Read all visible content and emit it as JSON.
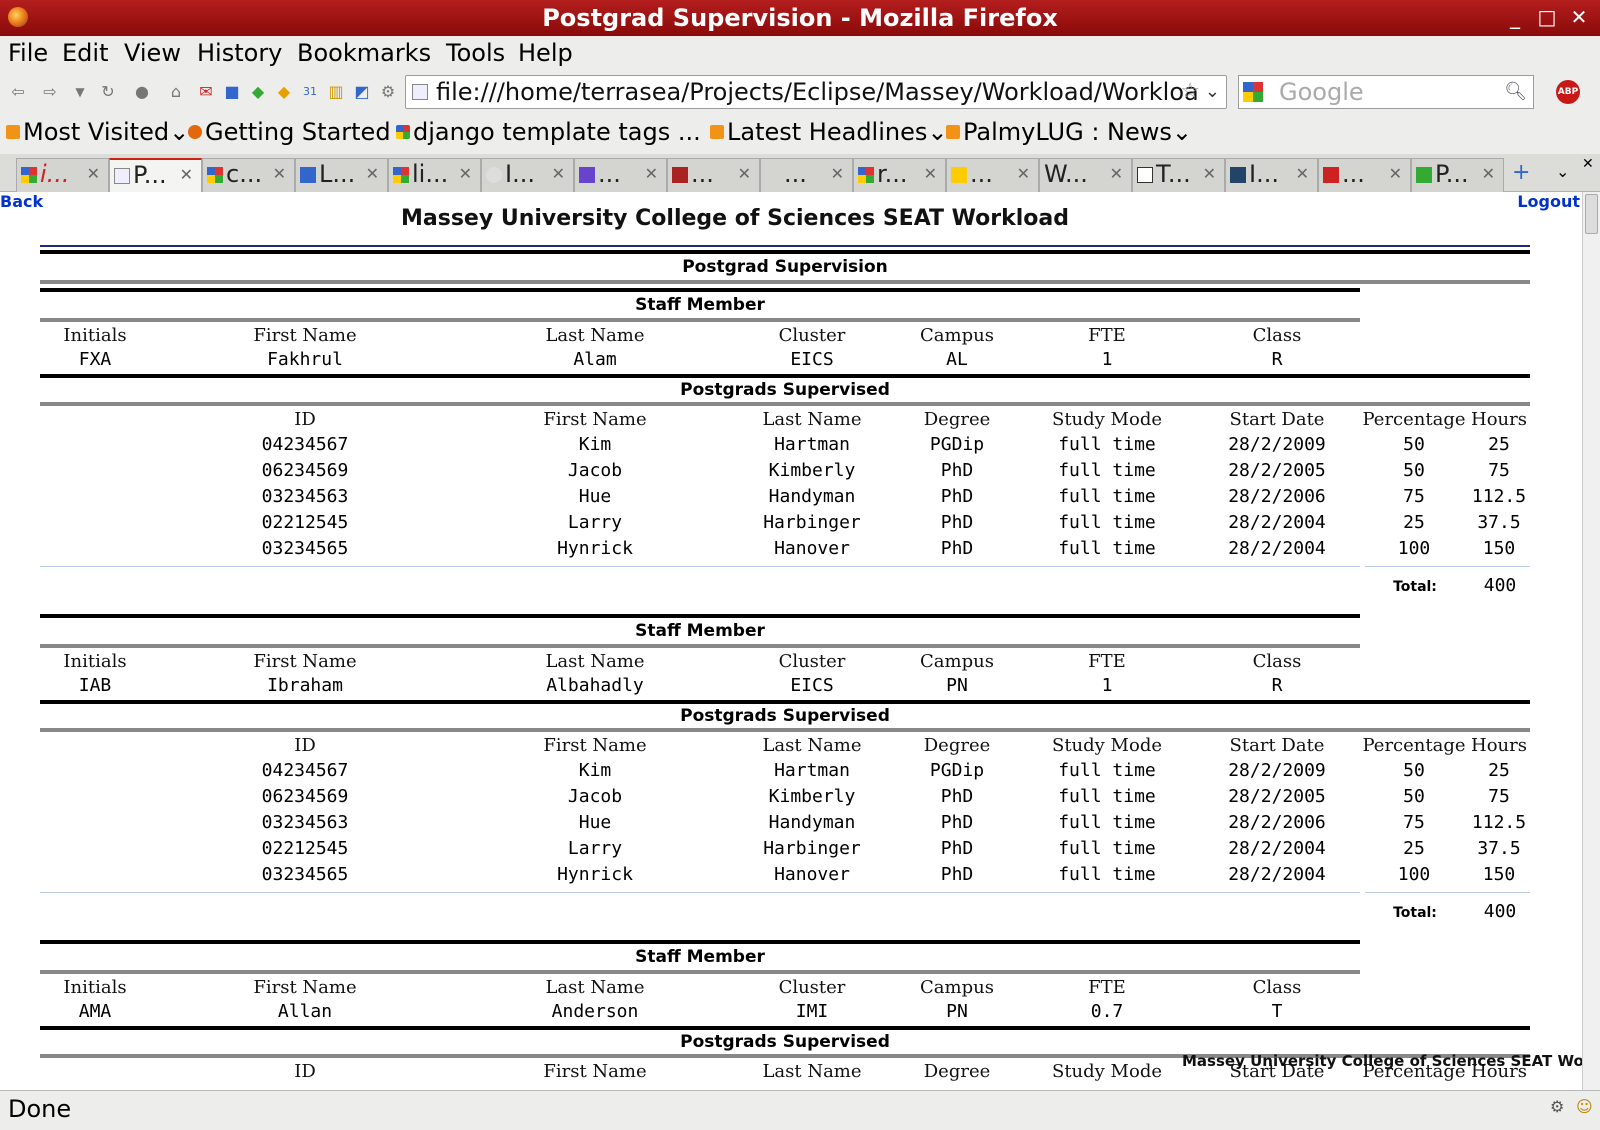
{
  "window": {
    "title": "Postgrad Supervision - Mozilla Firefox"
  },
  "menu": [
    "File",
    "Edit",
    "View",
    "History",
    "Bookmarks",
    "Tools",
    "Help"
  ],
  "nav": {
    "url": "file:///home/terrasea/Projects/Eclipse/Massey/Workload/Workloa",
    "search_placeholder": "Google",
    "abp": "ABP"
  },
  "bookmarks": [
    "Most Visited",
    "Getting Started",
    "django template tags ...",
    "Latest Headlines",
    "PalmyLUG : News"
  ],
  "tabs": [
    "i...",
    "P...",
    "c...",
    "L...",
    "li...",
    "I...",
    "...",
    "...",
    "...",
    "r...",
    "...",
    "W...",
    "T...",
    "I...",
    "...",
    "P..."
  ],
  "page": {
    "back": "Back",
    "logout": "Logout",
    "title": "Massey University College of Sciences SEAT Workload",
    "section": "Postgrad Supervision",
    "staff_heading": "Staff Member",
    "postgrads_heading": "Postgrads Supervised",
    "staff_cols": [
      "Initials",
      "First Name",
      "Last Name",
      "Cluster",
      "Campus",
      "FTE",
      "Class"
    ],
    "pg_cols": [
      "ID",
      "First Name",
      "Last Name",
      "Degree",
      "Study Mode",
      "Start Date",
      "Percentage",
      "Hours"
    ],
    "total_label": "Total:",
    "staff": [
      {
        "row": [
          "FXA",
          "Fakhrul",
          "Alam",
          "EICS",
          "AL",
          "1",
          "R"
        ],
        "postgrads": [
          [
            "04234567",
            "Kim",
            "Hartman",
            "PGDip",
            "full time",
            "28/2/2009",
            "50",
            "25"
          ],
          [
            "06234569",
            "Jacob",
            "Kimberly",
            "PhD",
            "full time",
            "28/2/2005",
            "50",
            "75"
          ],
          [
            "03234563",
            "Hue",
            "Handyman",
            "PhD",
            "full time",
            "28/2/2006",
            "75",
            "112.5"
          ],
          [
            "02212545",
            "Larry",
            "Harbinger",
            "PhD",
            "full time",
            "28/2/2004",
            "25",
            "37.5"
          ],
          [
            "03234565",
            "Hynrick",
            "Hanover",
            "PhD",
            "full time",
            "28/2/2004",
            "100",
            "150"
          ]
        ],
        "total": "400"
      },
      {
        "row": [
          "IAB",
          "Ibraham",
          "Albahadly",
          "EICS",
          "PN",
          "1",
          "R"
        ],
        "postgrads": [
          [
            "04234567",
            "Kim",
            "Hartman",
            "PGDip",
            "full time",
            "28/2/2009",
            "50",
            "25"
          ],
          [
            "06234569",
            "Jacob",
            "Kimberly",
            "PhD",
            "full time",
            "28/2/2005",
            "50",
            "75"
          ],
          [
            "03234563",
            "Hue",
            "Handyman",
            "PhD",
            "full time",
            "28/2/2006",
            "75",
            "112.5"
          ],
          [
            "02212545",
            "Larry",
            "Harbinger",
            "PhD",
            "full time",
            "28/2/2004",
            "25",
            "37.5"
          ],
          [
            "03234565",
            "Hynrick",
            "Hanover",
            "PhD",
            "full time",
            "28/2/2004",
            "100",
            "150"
          ]
        ],
        "total": "400"
      },
      {
        "row": [
          "AMA",
          "Allan",
          "Anderson",
          "IMI",
          "PN",
          "0.7",
          "T"
        ],
        "postgrads": [],
        "total": ""
      }
    ],
    "footer_overlay": "Massey University College of Sciences SEAT Workload"
  },
  "status": {
    "text": "Done"
  }
}
